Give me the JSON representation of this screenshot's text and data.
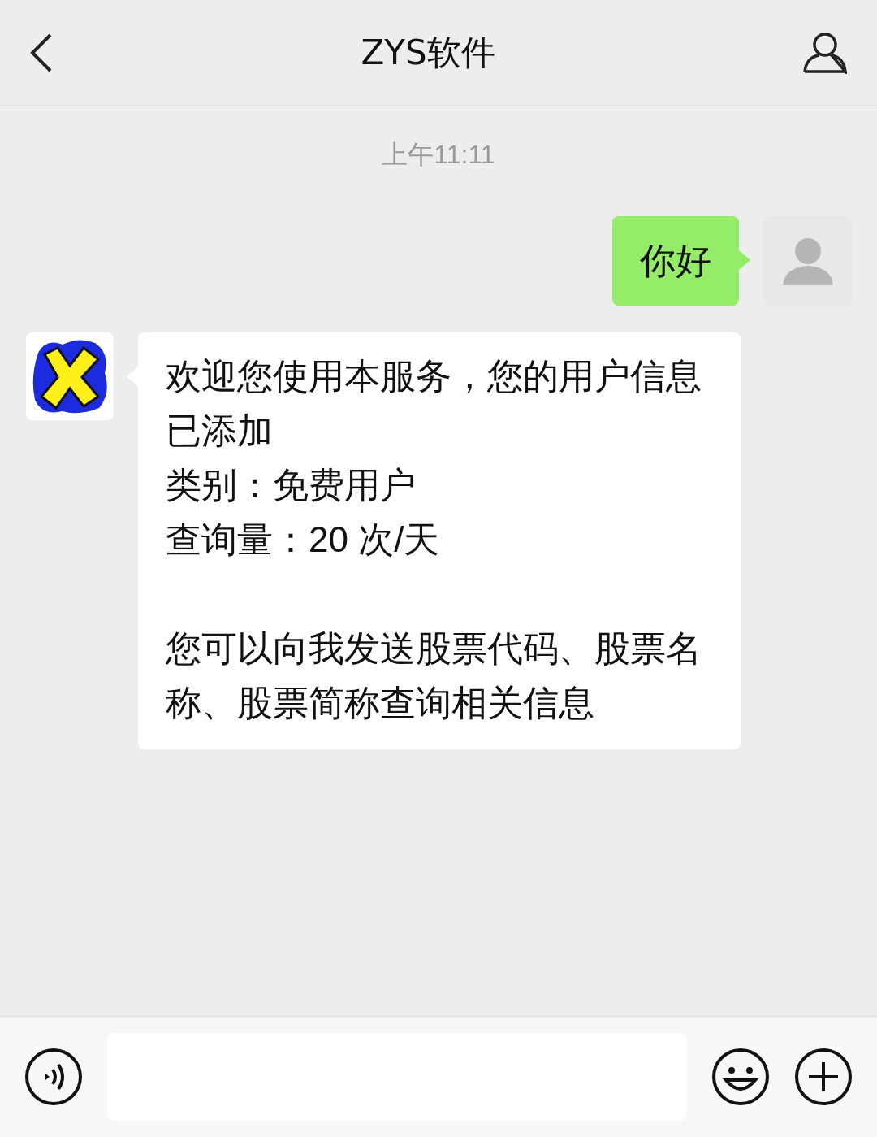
{
  "header": {
    "title": "ZYS软件"
  },
  "timestamp": "上午11:11",
  "messages": [
    {
      "kind": "outgoing",
      "text": "你好"
    },
    {
      "kind": "incoming",
      "paragraphs": [
        [
          "欢迎您使用本服务，您的用户信息已添加",
          "类别：免费用户",
          "查询量：20 次/天"
        ],
        [
          "您可以向我发送股票代码、股票名称、股票简称查询相关信息"
        ]
      ]
    }
  ]
}
